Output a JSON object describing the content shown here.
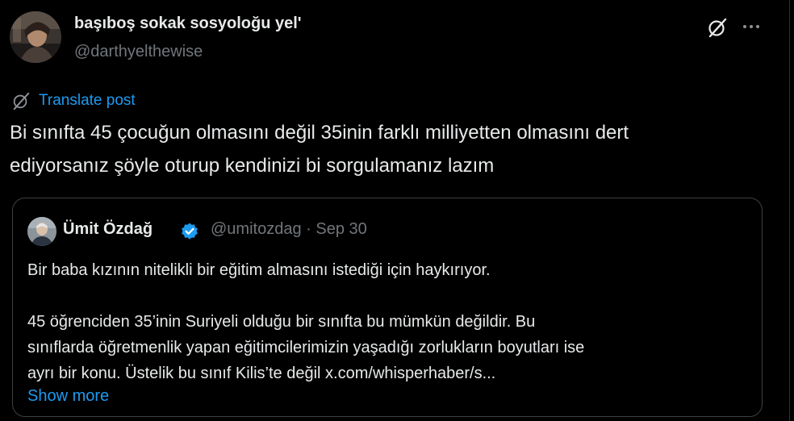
{
  "author": {
    "display_name": "başıboş sokak sosyoloğu yel'",
    "handle": "@darthyelthewise"
  },
  "icons": {
    "grok": "grok-icon",
    "more": "more-icon",
    "translate": "grok-icon",
    "verified": "verified-badge-icon"
  },
  "translate": {
    "label": "Translate post"
  },
  "tweet": {
    "line1": "Bi sınıfta 45 çocuğun olmasını değil 35inin farklı milliyetten olmasını dert",
    "line2": "ediyorsanız şöyle oturup kendinizi bi sorgulamanız lazım"
  },
  "quote": {
    "display_name": "Ümit Özdağ",
    "meta": "@umitozdag · Sep 30",
    "paragraph1": "Bir baba kızının nitelikli bir eğitim almasını istediği için haykırıyor.",
    "paragraph2_line1": "45 öğrenciden 35’inin Suriyeli olduğu bir sınıfta bu mümkün değildir. Bu",
    "paragraph2_line2": "sınıflarda öğretmenlik yapan eğitimcilerimizin yaşadığı zorlukların boyutları ise",
    "paragraph2_line3": "ayrı bir konu. Üstelik bu sınıf Kilis’te değil x.com/whisperhaber/s...",
    "show_more": "Show more"
  },
  "colors": {
    "background": "#000000",
    "text_primary": "#e7e9ea",
    "text_secondary": "#71767b",
    "accent": "#1d9bf0",
    "border": "#3c4043"
  }
}
